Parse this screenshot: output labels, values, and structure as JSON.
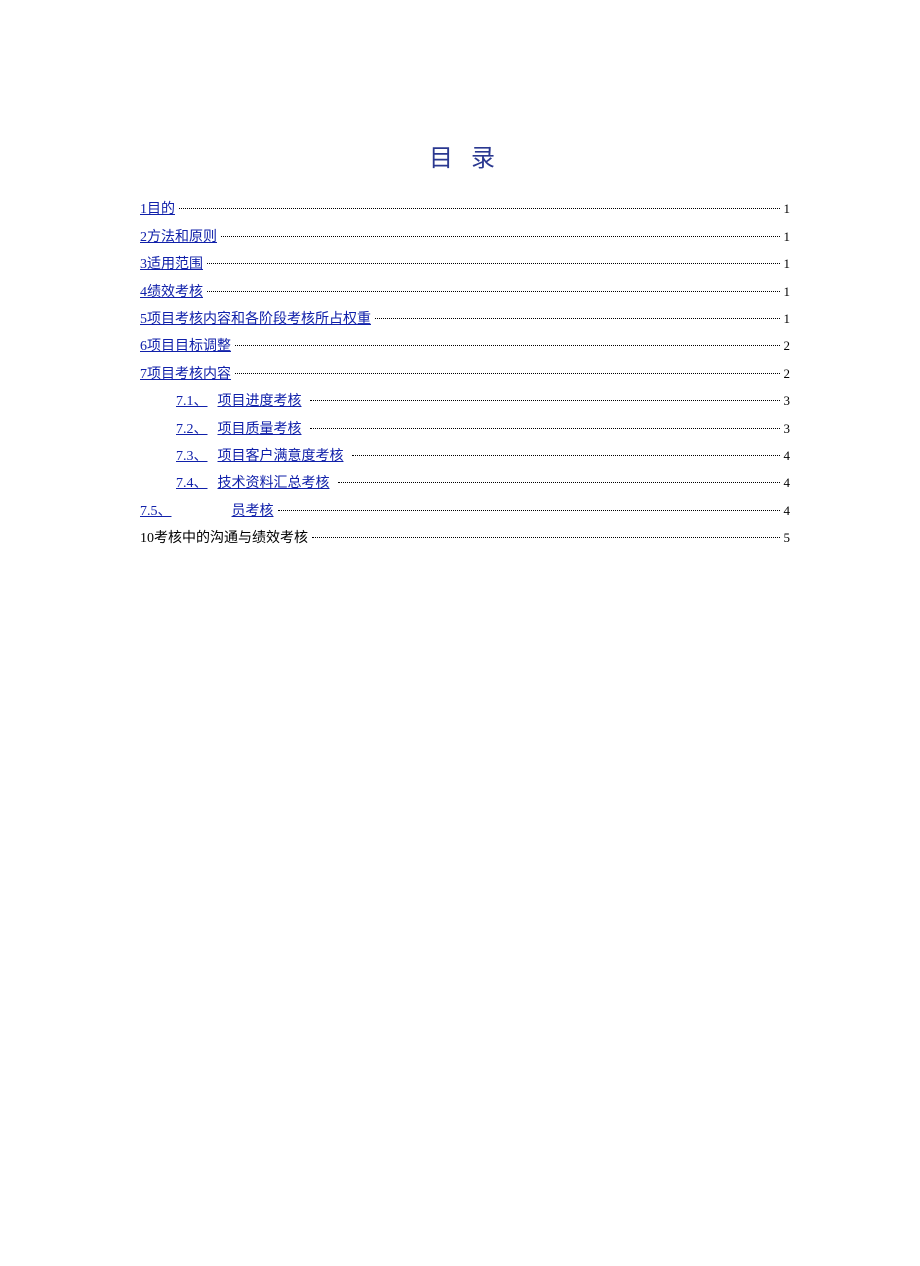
{
  "title": "目 录",
  "toc": [
    {
      "type": "l1",
      "link_text": "1目的",
      "page": "1"
    },
    {
      "type": "l1",
      "link_text": "2方法和原则",
      "page": "1"
    },
    {
      "type": "l1",
      "link_text": "3适用范围",
      "page": "1"
    },
    {
      "type": "l1",
      "link_text": "4绩效考核",
      "page": "1"
    },
    {
      "type": "l1",
      "link_text": "5项目考核内容和各阶段考核所占权重",
      "page": "1"
    },
    {
      "type": "l1",
      "link_text": "6项目目标调整",
      "page": "2"
    },
    {
      "type": "l1",
      "link_text": "7项目考核内容",
      "page": "2"
    },
    {
      "type": "l2",
      "num": "7.1、",
      "link_text": "项目进度考核",
      "page": "3"
    },
    {
      "type": "l2",
      "num": "7.2、",
      "link_text": "项目质量考核",
      "page": "3"
    },
    {
      "type": "l2",
      "num": "7.3、",
      "link_text": "项目客户满意度考核",
      "page": "4"
    },
    {
      "type": "l2",
      "num": "7.4、",
      "link_text": "技术资料汇总考核",
      "page": "4"
    },
    {
      "type": "l2w",
      "num": "7.5、",
      "link_text": "员考核",
      "page": "4"
    },
    {
      "type": "l1p",
      "link_text": "10考核中的沟通与绩效考核",
      "page": "5"
    }
  ]
}
